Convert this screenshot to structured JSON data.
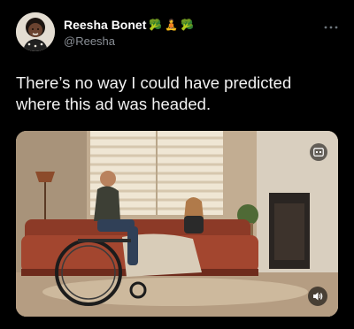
{
  "author": {
    "display_name": "Reesha Bonet",
    "handle": "@Reesha",
    "emoji_badges": [
      "🥦",
      "🧘",
      "🥦"
    ]
  },
  "tweet": {
    "text": "There’s no way I could have predicted where this ad was headed."
  },
  "icons": {
    "more": "more-icon",
    "caption": "caption-icon",
    "volume": "volume-icon"
  },
  "colors": {
    "background": "#000000",
    "handle": "#8a8f96"
  }
}
